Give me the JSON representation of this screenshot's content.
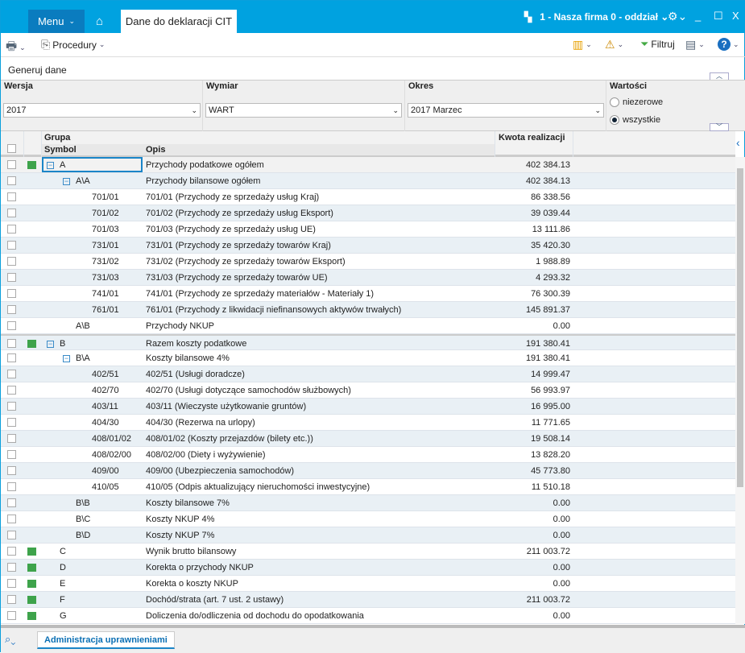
{
  "titlebar": {
    "menu": "Menu",
    "tab": "Dane do deklaracji CIT",
    "firm": "1 - Nasza firma 0 - oddział",
    "minimize": "_",
    "maximize": "☐",
    "close": "X"
  },
  "toolbar": {
    "procedury": "Procedury",
    "filtruj": "Filtruj"
  },
  "generuj": "Generuj dane",
  "filters": {
    "wersja_label": "Wersja",
    "wersja": "2017",
    "wymiar_label": "Wymiar",
    "wymiar": "WART",
    "okres_label": "Okres",
    "okres": "2017 Marzec",
    "wartosci_label": "Wartości",
    "opt1": "niezerowe",
    "opt2": "wszystkie",
    "selected": "wszystkie"
  },
  "grid": {
    "headers": {
      "grupa": "Grupa",
      "symbol": "Symbol",
      "opis": "Opis",
      "kwota": "Kwota realizacji"
    },
    "rows": [
      {
        "level": 0,
        "flag": true,
        "exp": true,
        "symbol": "A",
        "opis": "Przychody podatkowe ogółem",
        "kwota": "402 384.13"
      },
      {
        "level": 1,
        "flag": false,
        "exp": true,
        "symbol": "A\\A",
        "opis": "Przychody bilansowe ogółem",
        "kwota": "402 384.13"
      },
      {
        "level": 2,
        "symbol": "701/01",
        "opis": "701/01  (Przychody ze sprzedaży usług Kraj)",
        "kwota": "86 338.56"
      },
      {
        "level": 2,
        "symbol": "701/02",
        "opis": "701/02  (Przychody ze sprzedaży usług Eksport)",
        "kwota": "39 039.44"
      },
      {
        "level": 2,
        "symbol": "701/03",
        "opis": "701/03  (Przychody ze sprzedaży usług UE)",
        "kwota": "13 111.86"
      },
      {
        "level": 2,
        "symbol": "731/01",
        "opis": "731/01  (Przychody ze sprzedaży towarów Kraj)",
        "kwota": "35 420.30"
      },
      {
        "level": 2,
        "symbol": "731/02",
        "opis": "731/02  (Przychody ze sprzedaży towarów Eksport)",
        "kwota": "1 988.89"
      },
      {
        "level": 2,
        "symbol": "731/03",
        "opis": "731/03  (Przychody ze sprzedaży towarów UE)",
        "kwota": "4 293.32"
      },
      {
        "level": 2,
        "symbol": "741/01",
        "opis": "741/01  (Przychody ze sprzedaży materiałów - Materiały 1)",
        "kwota": "76 300.39"
      },
      {
        "level": 2,
        "symbol": "761/01",
        "opis": "761/01  (Przychody z likwidacji niefinansowych aktywów trwałych)",
        "kwota": "145 891.37"
      },
      {
        "level": 1,
        "symbol": "A\\B",
        "opis": "Przychody NKUP",
        "kwota": "0.00"
      },
      {
        "level": 0,
        "flag": true,
        "exp": true,
        "symbol": "B",
        "opis": "Razem koszty podatkowe",
        "kwota": "191 380.41"
      },
      {
        "level": 1,
        "exp": true,
        "symbol": "B\\A",
        "opis": "Koszty bilansowe 4%",
        "kwota": "191 380.41"
      },
      {
        "level": 2,
        "symbol": "402/51",
        "opis": "402/51  (Usługi doradcze)",
        "kwota": "14 999.47"
      },
      {
        "level": 2,
        "symbol": "402/70",
        "opis": "402/70  (Usługi dotyczące samochodów służbowych)",
        "kwota": "56 993.97"
      },
      {
        "level": 2,
        "symbol": "403/11",
        "opis": "403/11  (Wieczyste użytkowanie gruntów)",
        "kwota": "16 995.00"
      },
      {
        "level": 2,
        "symbol": "404/30",
        "opis": "404/30  (Rezerwa na urlopy)",
        "kwota": "11 771.65"
      },
      {
        "level": 2,
        "symbol": "408/01/02",
        "opis": "408/01/02  (Koszty przejazdów (bilety etc.))",
        "kwota": "19 508.14"
      },
      {
        "level": 2,
        "symbol": "408/02/00",
        "opis": "408/02/00  (Diety i wyżywienie)",
        "kwota": "13 828.20"
      },
      {
        "level": 2,
        "symbol": "409/00",
        "opis": "409/00  (Ubezpieczenia samochodów)",
        "kwota": "45 773.80"
      },
      {
        "level": 2,
        "symbol": "410/05",
        "opis": "410/05  (Odpis aktualizujący nieruchomości inwestycyjne)",
        "kwota": "11 510.18"
      },
      {
        "level": 1,
        "symbol": "B\\B",
        "opis": "Koszty bilansowe 7%",
        "kwota": "0.00"
      },
      {
        "level": 1,
        "symbol": "B\\C",
        "opis": "Koszty NKUP 4%",
        "kwota": "0.00"
      },
      {
        "level": 1,
        "symbol": "B\\D",
        "opis": "Koszty NKUP 7%",
        "kwota": "0.00"
      },
      {
        "level": 0,
        "flag": true,
        "symbol": "C",
        "opis": "Wynik brutto bilansowy",
        "kwota": "211 003.72"
      },
      {
        "level": 0,
        "flag": true,
        "symbol": "D",
        "opis": "Korekta o przychody NKUP",
        "kwota": "0.00"
      },
      {
        "level": 0,
        "flag": true,
        "symbol": "E",
        "opis": "Korekta o koszty NKUP",
        "kwota": "0.00"
      },
      {
        "level": 0,
        "flag": true,
        "symbol": "F",
        "opis": "Dochód/strata (art. 7 ust. 2 ustawy)",
        "kwota": "211 003.72"
      },
      {
        "level": 0,
        "flag": true,
        "symbol": "G",
        "opis": "Doliczenia do/odliczenia od dochodu do opodatkowania",
        "kwota": "0.00"
      }
    ]
  },
  "bottom": {
    "tab": "Administracja uprawnieniami"
  },
  "colors": {
    "accent": "#00a2e0",
    "flag": "#3ea34b"
  }
}
